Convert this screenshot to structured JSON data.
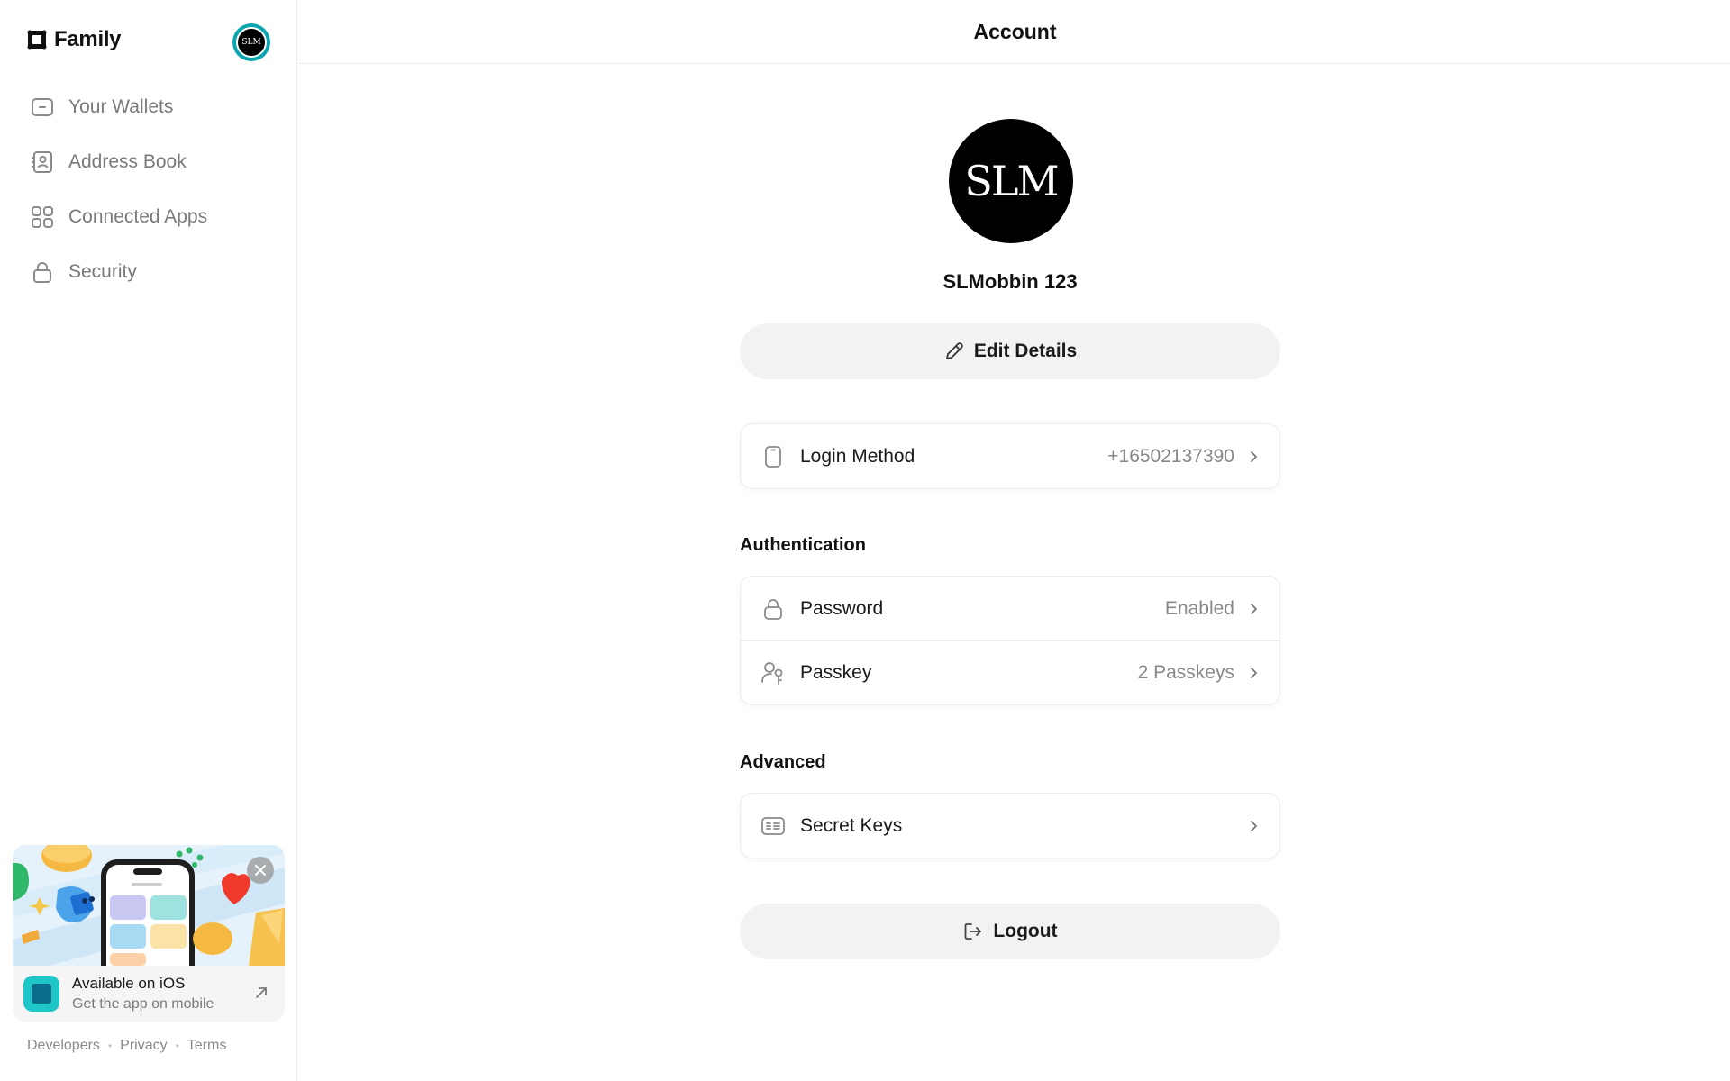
{
  "app": {
    "brand": "Family",
    "avatar_text": "SLM"
  },
  "sidebar": {
    "items": [
      {
        "label": "Your Wallets",
        "icon": "wallet-icon"
      },
      {
        "label": "Address Book",
        "icon": "contact-book-icon"
      },
      {
        "label": "Connected Apps",
        "icon": "apps-grid-icon"
      },
      {
        "label": "Security",
        "icon": "lock-icon"
      }
    ],
    "promo": {
      "title": "Available on iOS",
      "subtitle": "Get the app on mobile"
    },
    "footer": {
      "developers": "Developers",
      "privacy": "Privacy",
      "terms": "Terms"
    }
  },
  "header": {
    "title": "Account"
  },
  "profile": {
    "avatar_text": "SLM",
    "name": "SLMobbin 123",
    "edit_label": "Edit Details"
  },
  "login": {
    "label": "Login Method",
    "value": "+16502137390"
  },
  "authentication": {
    "title": "Authentication",
    "password_label": "Password",
    "password_value": "Enabled",
    "passkey_label": "Passkey",
    "passkey_value": "2 Passkeys"
  },
  "advanced": {
    "title": "Advanced",
    "secret_keys_label": "Secret Keys"
  },
  "logout_label": "Logout",
  "colors": {
    "accent_teal": "#0aa6b0",
    "button_bg": "#f2f2f3",
    "muted_text": "#888888"
  }
}
